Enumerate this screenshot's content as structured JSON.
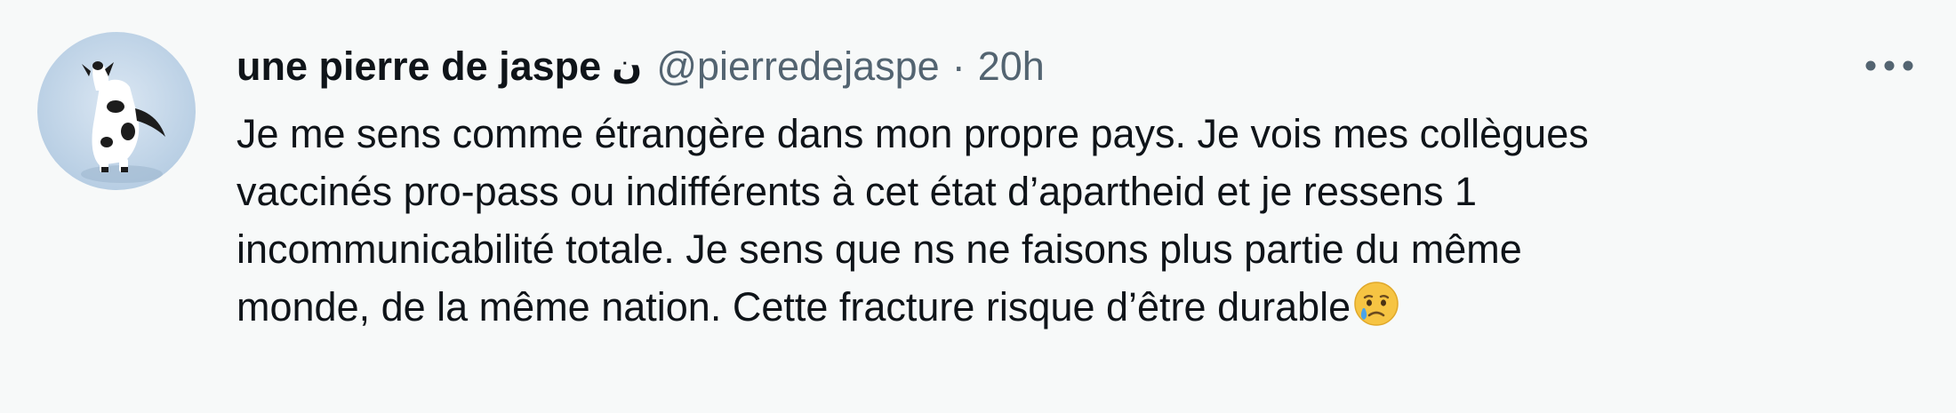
{
  "tweet": {
    "author": {
      "display_name": "une pierre de jaspe",
      "name_glyph": "ن",
      "handle": "@pierredejaspe"
    },
    "separator": "·",
    "timestamp": "20h",
    "more_icon": "more-horizontal-icon",
    "text_lines": [
      "Je me sens comme étrangère dans mon propre pays. Je vois mes collègues",
      "vaccinés pro-pass ou indifférents à cet état d’apartheid et je ressens 1",
      "incommunicabilité totale. Je sens que ns ne faisons plus partie du même",
      "monde, de la même nation. Cette fracture risque d’être durable"
    ],
    "trailing_emoji": "crying-face-emoji"
  },
  "colors": {
    "background": "#f7f9f9",
    "text_primary": "#0f1419",
    "text_secondary": "#536471"
  }
}
